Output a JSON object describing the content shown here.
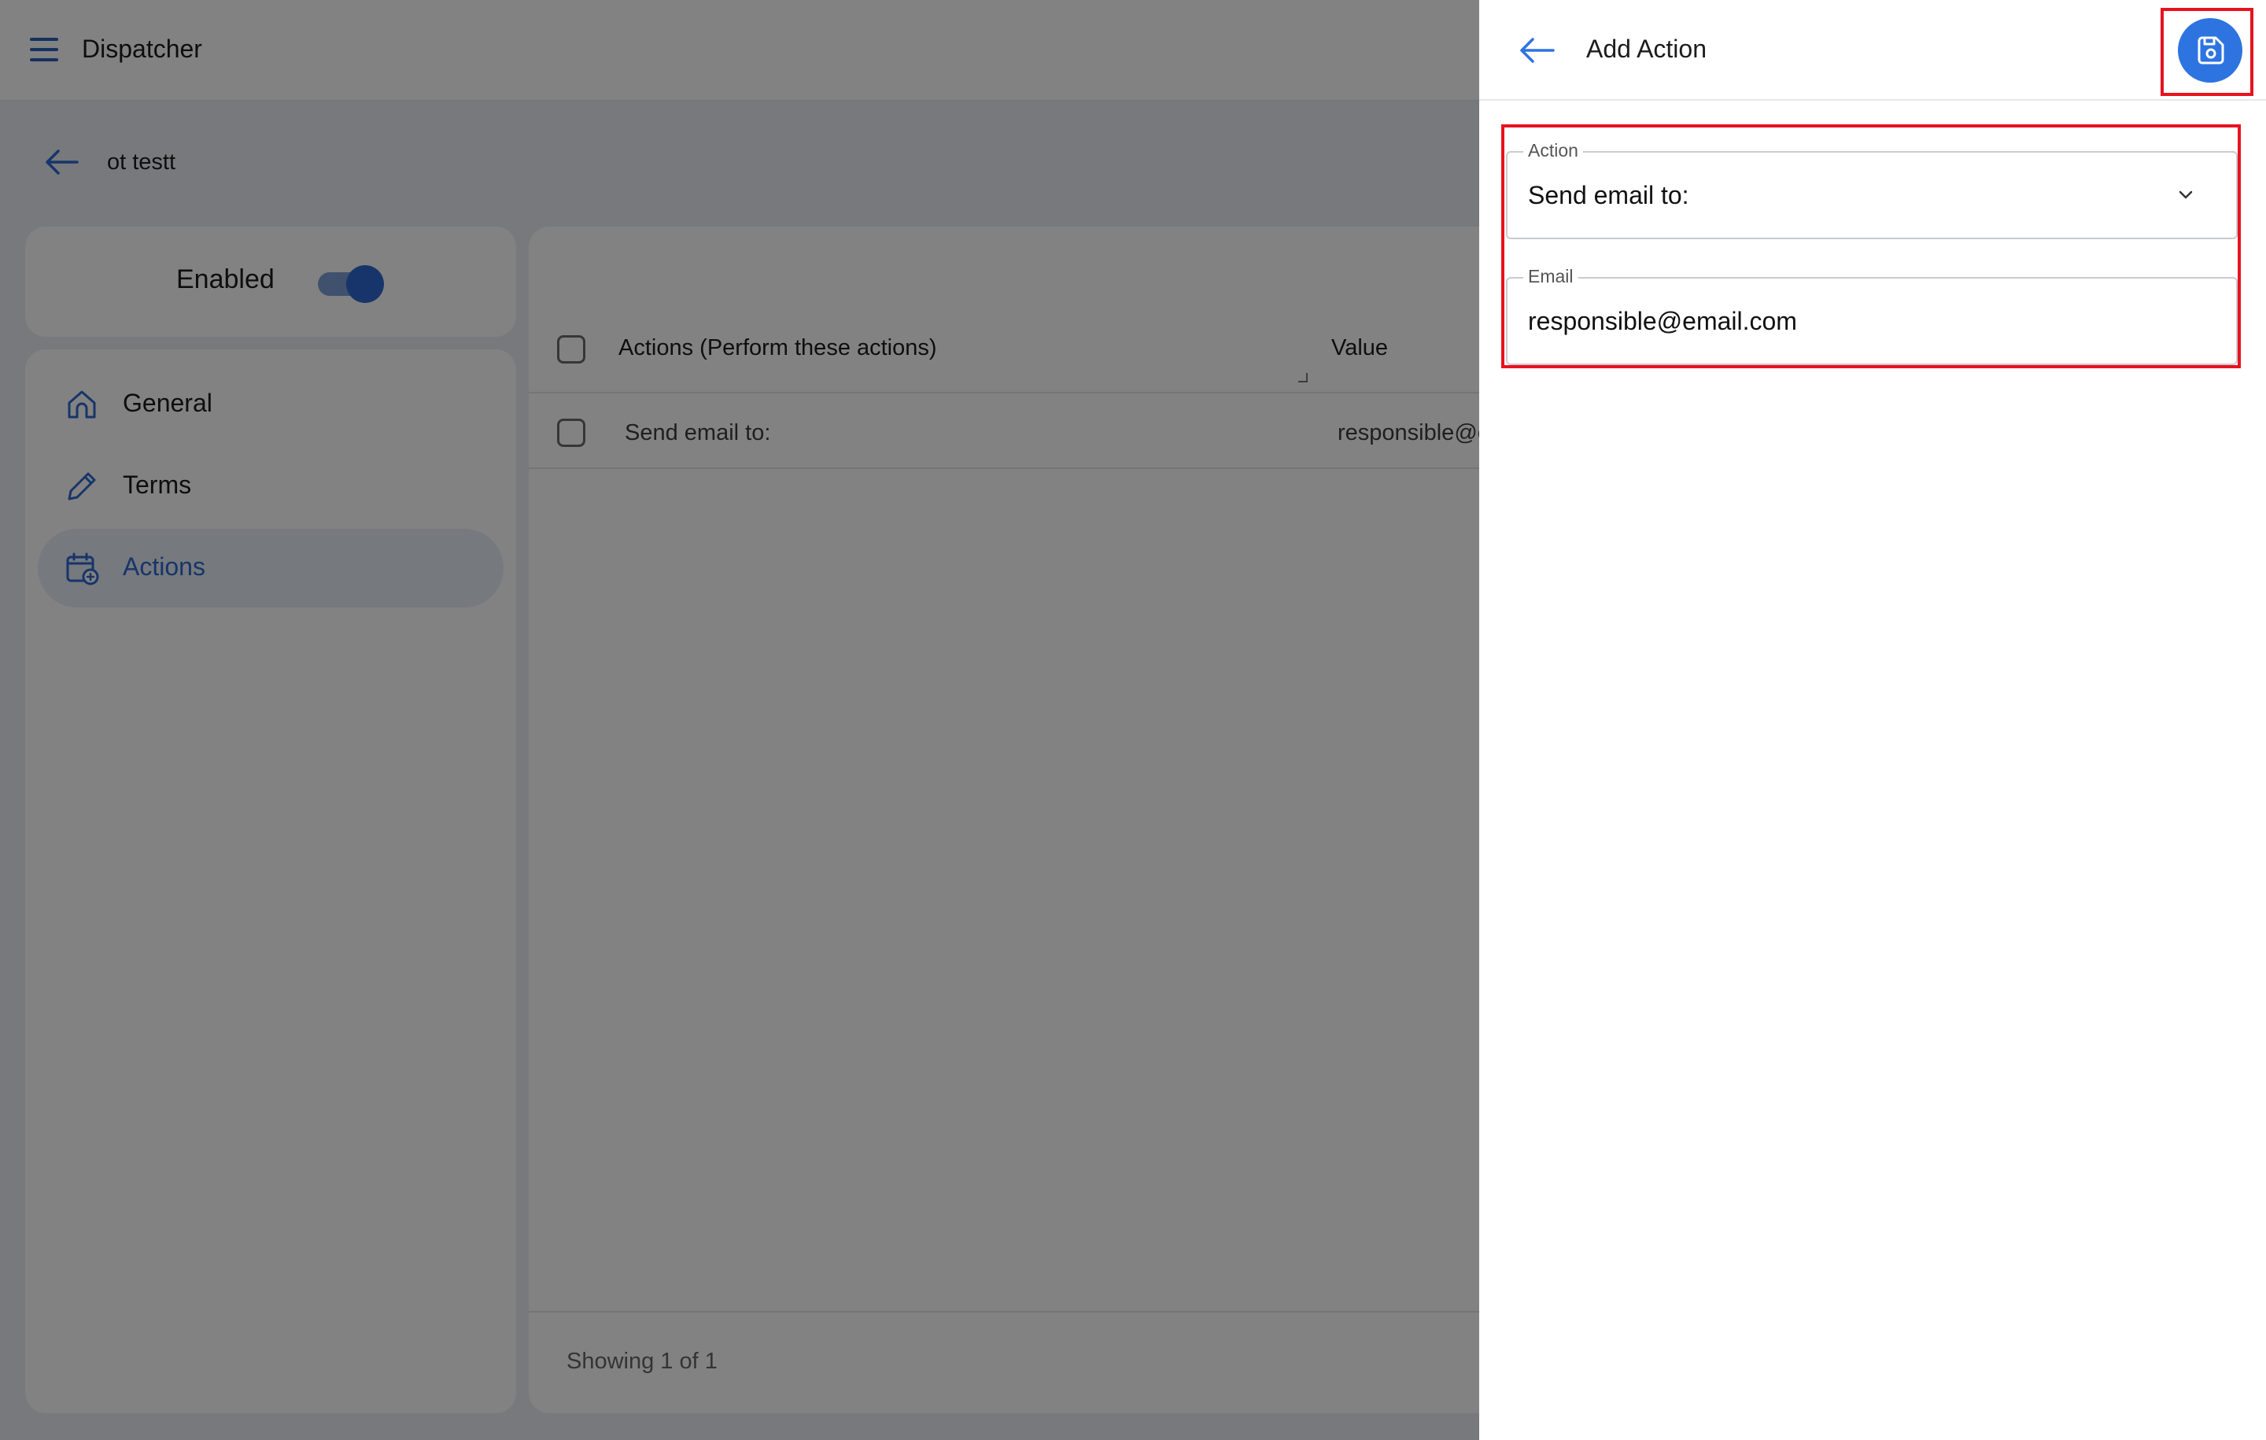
{
  "app": {
    "title": "Dispatcher"
  },
  "record": {
    "title": "ot testt"
  },
  "status": {
    "label": "Enabled",
    "enabled": true
  },
  "nav": {
    "items": [
      {
        "label": "General",
        "icon": "home-icon"
      },
      {
        "label": "Terms",
        "icon": "pencil-icon"
      },
      {
        "label": "Actions",
        "icon": "calendar-add-icon",
        "active": true
      }
    ]
  },
  "table": {
    "columns": [
      "Actions (Perform these actions)",
      "Value"
    ],
    "rows": [
      {
        "action": "Send email to:",
        "value": "responsible@e"
      }
    ],
    "footer": "Showing 1 of 1"
  },
  "panel": {
    "title": "Add Action",
    "save_icon": "save-icon",
    "action_field": {
      "label": "Action",
      "value": "Send email to:"
    },
    "email_field": {
      "label": "Email",
      "value": "responsible@email.com"
    }
  },
  "colors": {
    "accent": "#2e68d0",
    "save_button": "#2e74e0",
    "highlight": "#e8121f"
  }
}
